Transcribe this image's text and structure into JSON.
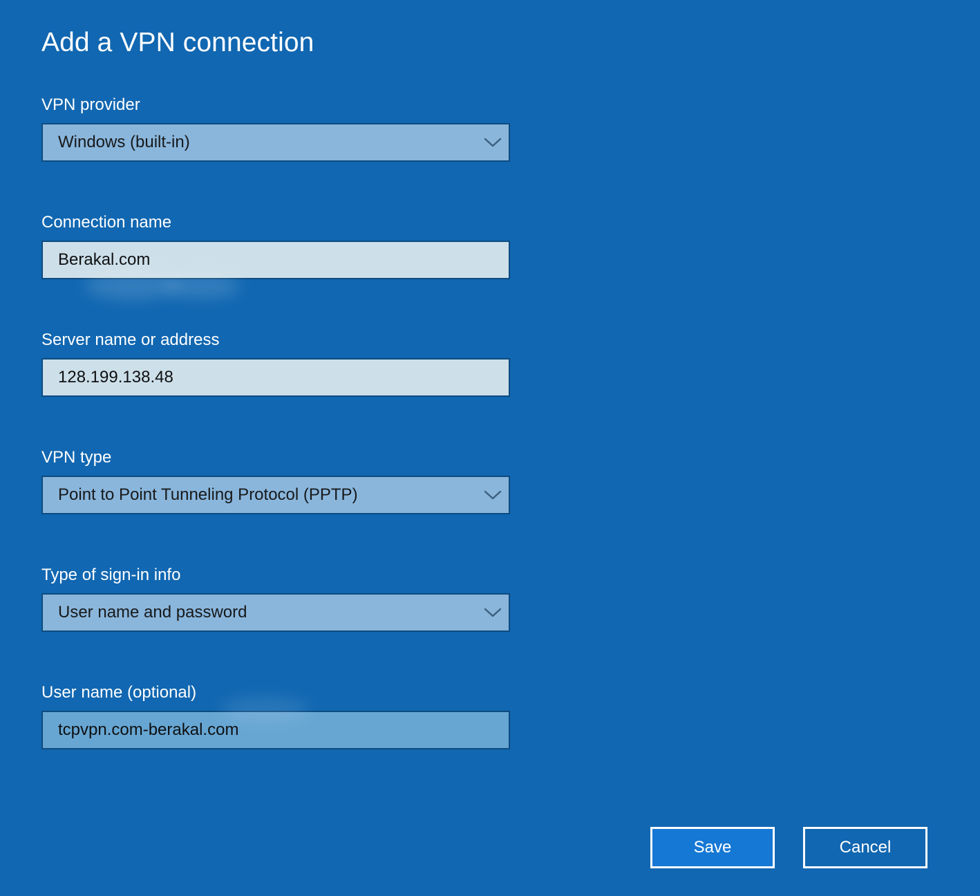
{
  "window": {
    "title": "Add a VPN connection",
    "background_color": "#1167b1"
  },
  "theme": {
    "background": "#1167b1",
    "combo_fill": "#8ab6dc",
    "textbox_fill": "#cddfe9",
    "textbox_alt_fill": "#67a6d3",
    "control_border": "#0c4b80",
    "label_color": "#ffffff",
    "value_color": "#17191a",
    "save_button_fill": "#1578d4",
    "button_border": "#ffffff"
  },
  "form": {
    "fields": [
      {
        "id": "vpn-provider",
        "label": "VPN provider",
        "type": "combobox",
        "value": "Windows (built-in)",
        "icon": "chevron-down-icon"
      },
      {
        "id": "connection-name",
        "label": "Connection name",
        "type": "textbox",
        "value": "Berakal.com",
        "placeholder": ""
      },
      {
        "id": "server-address",
        "label": "Server name or address",
        "type": "textbox",
        "value": "128.199.138.48",
        "placeholder": ""
      },
      {
        "id": "vpn-type",
        "label": "VPN type",
        "type": "combobox",
        "value": "Point to Point Tunneling Protocol (PPTP)",
        "icon": "chevron-down-icon"
      },
      {
        "id": "sign-in-type",
        "label": "Type of sign-in info",
        "type": "combobox",
        "value": "User name and password",
        "icon": "chevron-down-icon"
      },
      {
        "id": "user-name",
        "label": "User name (optional)",
        "type": "textbox",
        "value": "tcpvpn.com-berakal.com",
        "placeholder": ""
      }
    ]
  },
  "footer": {
    "save_label": "Save",
    "cancel_label": "Cancel"
  }
}
